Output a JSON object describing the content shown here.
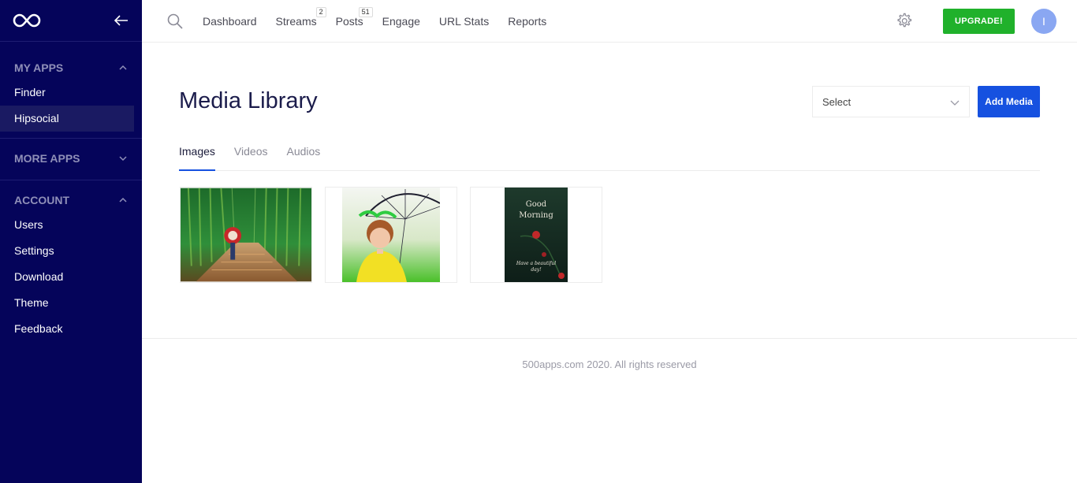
{
  "sidebar": {
    "sections": [
      {
        "title": "MY APPS",
        "expanded": true,
        "items": [
          "Finder",
          "Hipsocial"
        ]
      },
      {
        "title": "MORE APPS",
        "expanded": false,
        "items": []
      },
      {
        "title": "ACCOUNT",
        "expanded": true,
        "items": [
          "Users",
          "Settings",
          "Download",
          "Theme",
          "Feedback"
        ]
      }
    ],
    "active_item": "Hipsocial"
  },
  "topbar": {
    "nav": [
      {
        "label": "Dashboard"
      },
      {
        "label": "Streams",
        "badge": "2"
      },
      {
        "label": "Posts",
        "badge": "51"
      },
      {
        "label": "Engage"
      },
      {
        "label": "URL Stats"
      },
      {
        "label": "Reports"
      }
    ],
    "upgrade_label": "UPGRADE!",
    "avatar_initial": "I"
  },
  "main": {
    "title": "Media Library",
    "select_value": "Select",
    "add_media_label": "Add Media",
    "tabs": [
      "Images",
      "Videos",
      "Audios"
    ],
    "active_tab": "Images",
    "images": [
      {
        "icon": "bamboo-forest-image"
      },
      {
        "icon": "girl-umbrella-image"
      },
      {
        "icon": "good-morning-card-image",
        "text_top": "Good\nMorning",
        "text_bottom": "Have a beautiful day!"
      }
    ]
  },
  "footer": {
    "text": "500apps.com 2020. All rights reserved"
  },
  "colors": {
    "sidebar_bg": "#05045a",
    "accent_blue": "#1651e0",
    "upgrade_green": "#20b12b",
    "avatar_bg": "#8aa7f2"
  }
}
